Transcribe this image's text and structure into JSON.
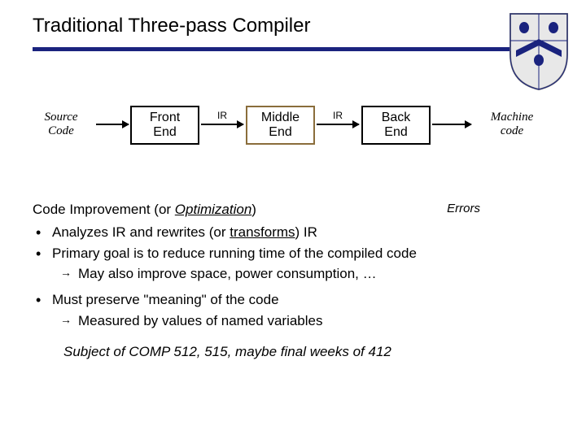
{
  "chart_data": {
    "type": "flow",
    "nodes": [
      "Source Code",
      "Front End",
      "Middle End",
      "Back End",
      "Machine code"
    ],
    "edges": [
      {
        "from": "Source Code",
        "to": "Front End"
      },
      {
        "from": "Front End",
        "to": "Middle End",
        "label": "IR"
      },
      {
        "from": "Middle End",
        "to": "Back End",
        "label": "IR"
      },
      {
        "from": "Back End",
        "to": "Machine code"
      }
    ],
    "highlight_node": "Middle End",
    "errors_label": "Errors"
  },
  "title": "Traditional Three-pass Compiler",
  "io": {
    "source_l1": "Source",
    "source_l2": "Code",
    "machine_l1": "Machine",
    "machine_l2": "code"
  },
  "box": {
    "front_l1": "Front",
    "front_l2": "End",
    "middle_l1": "Middle",
    "middle_l2": "End",
    "back_l1": "Back",
    "back_l2": "End"
  },
  "arrow": {
    "ir1": "IR",
    "ir2": "IR"
  },
  "errors": "Errors",
  "heading_prefix": "Code Improvement (or ",
  "heading_term": "Optimization",
  "heading_suffix": ")",
  "b1_a": "Analyzes IR and rewrites (or ",
  "b1_b": "transforms",
  "b1_c": ") IR",
  "b2": "Primary goal is to reduce running time of the compiled code",
  "b2_sub": "May also improve space, power consumption, …",
  "b3": "Must preserve \"meaning\" of the code",
  "b3_sub": "Measured by values of named variables",
  "subject": "Subject of COMP 512, 515, maybe final weeks of 412"
}
